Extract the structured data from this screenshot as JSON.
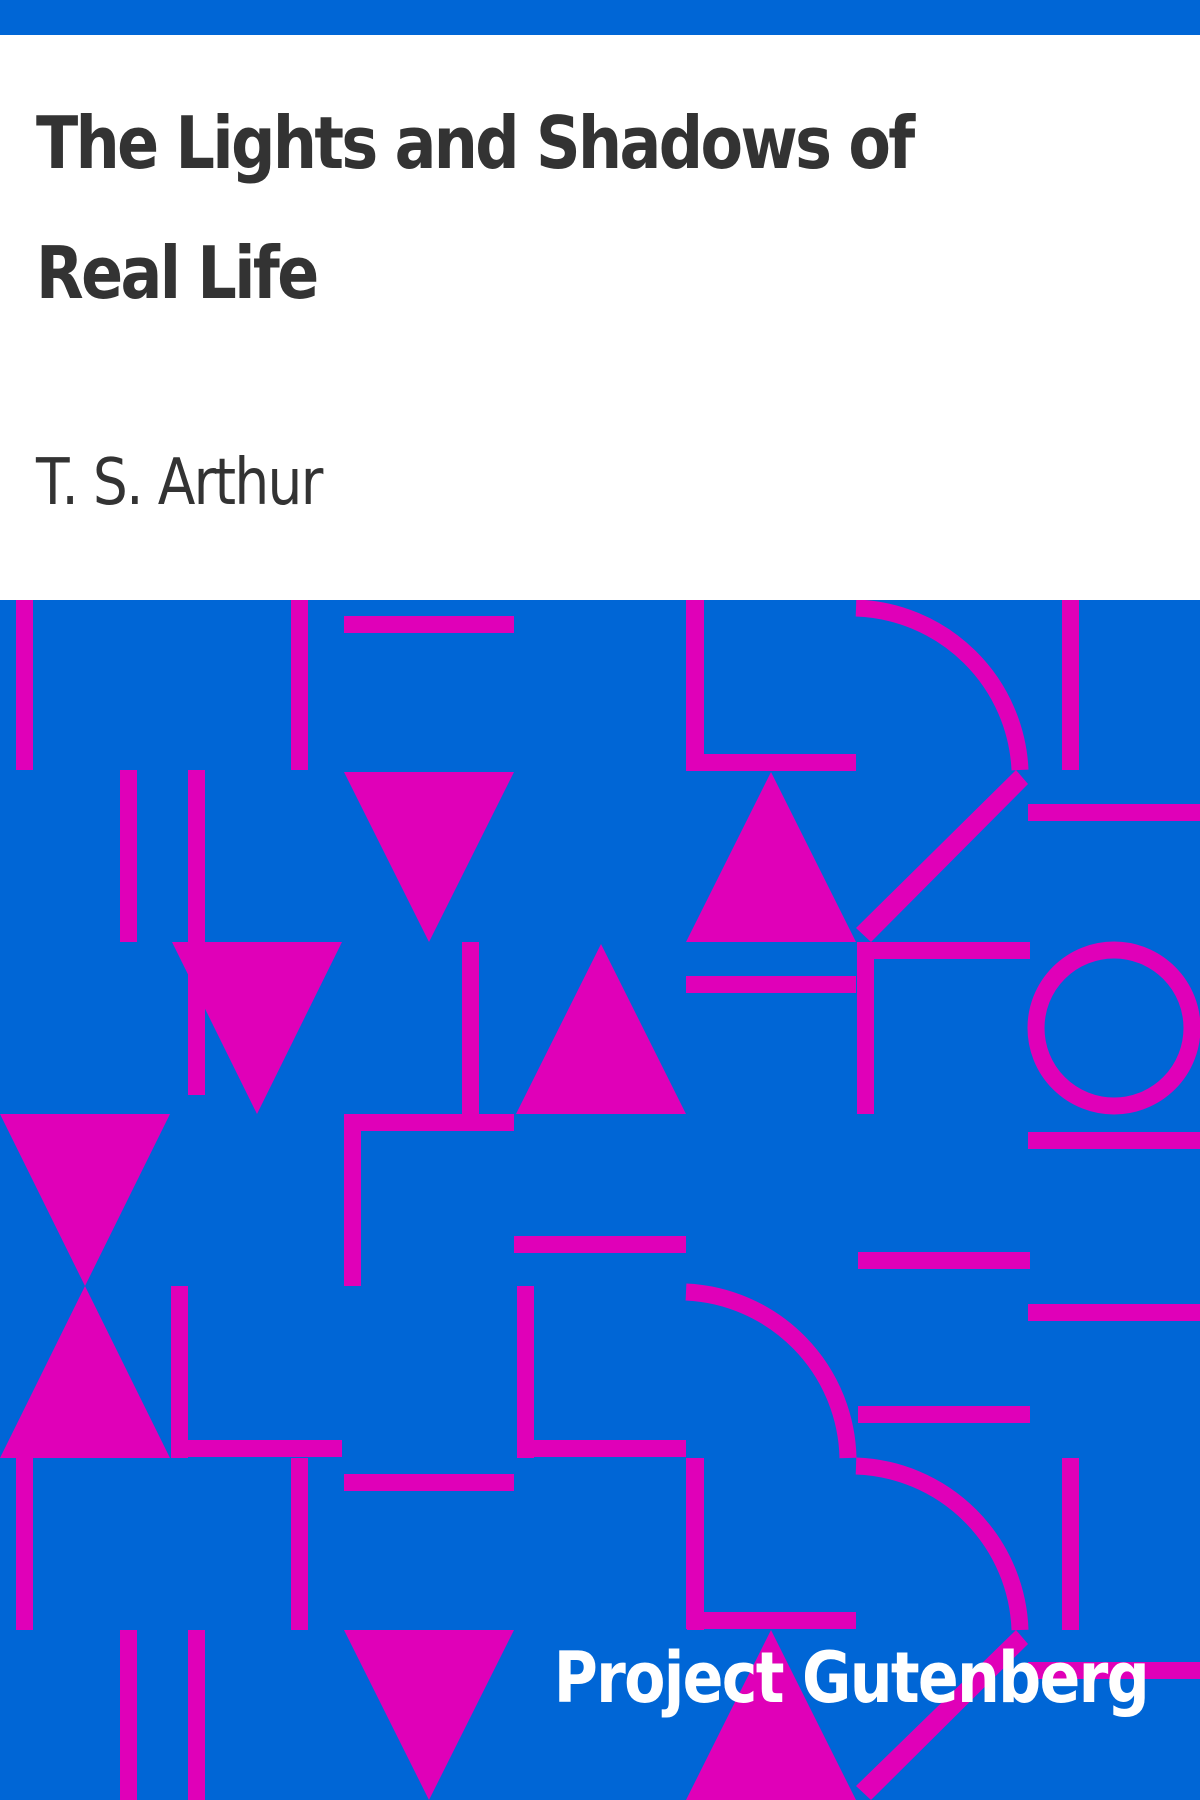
{
  "book": {
    "title": "The Lights and Shadows of Real Life",
    "author": "T. S. Arthur",
    "publisher": "Project Gutenberg"
  },
  "colors": {
    "background": "#ffffff",
    "pattern_background": "#0066d6",
    "pattern_shapes": "#e000b8",
    "title_text": "#333333",
    "publisher_text": "#ffffff"
  }
}
